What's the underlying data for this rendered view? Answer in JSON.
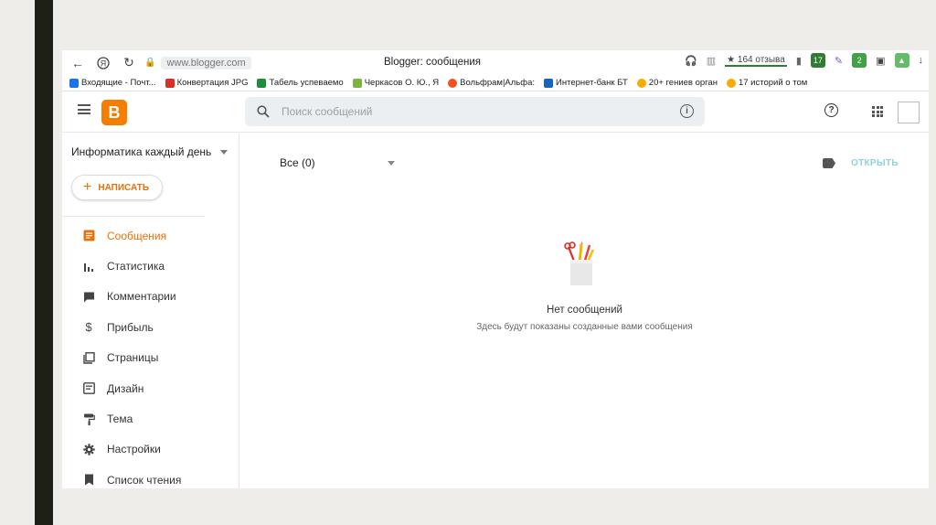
{
  "browser": {
    "url": "www.blogger.com",
    "page_title": "Blogger: сообщения",
    "reviews": "★ 164 отзыва",
    "ext_badge_1": "17",
    "ext_badge_2": "2"
  },
  "bookmarks": [
    {
      "label": "Входящие - Почт...",
      "color": "#1a73e8"
    },
    {
      "label": "Конвертация JPG",
      "color": "#d93025"
    },
    {
      "label": "Табель успеваемо",
      "color": "#1e8e3e"
    },
    {
      "label": "Черкасов О. Ю., Я",
      "color": "#7cb342"
    },
    {
      "label": "Вольфрам|Альфа:",
      "color": "#f4511e"
    },
    {
      "label": "Интернет-банк БТ",
      "color": "#1565c0"
    },
    {
      "label": "20+ гениев орган",
      "color": "#f9ab00"
    },
    {
      "label": "17 историй о том",
      "color": "#f9ab00"
    }
  ],
  "header": {
    "logo_letter": "B",
    "search_placeholder": "Поиск сообщений"
  },
  "sidebar": {
    "blog_name": "Информатика каждый день",
    "new_post": "НАПИСАТЬ",
    "items": [
      {
        "label": "Сообщения",
        "icon": "posts-icon",
        "active": true
      },
      {
        "label": "Статистика",
        "icon": "stats-icon",
        "active": false
      },
      {
        "label": "Комментарии",
        "icon": "comments-icon",
        "active": false
      },
      {
        "label": "Прибыль",
        "icon": "earnings-icon",
        "active": false
      },
      {
        "label": "Страницы",
        "icon": "pages-icon",
        "active": false
      },
      {
        "label": "Дизайн",
        "icon": "layout-icon",
        "active": false
      },
      {
        "label": "Тема",
        "icon": "theme-icon",
        "active": false
      },
      {
        "label": "Настройки",
        "icon": "settings-icon",
        "active": false
      },
      {
        "label": "Список чтения",
        "icon": "reading-list-icon",
        "active": false
      }
    ]
  },
  "main": {
    "filter": "Все (0)",
    "open_button": "ОТКРЫТЬ",
    "empty_title": "Нет сообщений",
    "empty_subtitle": "Здесь будут показаны созданные вами сообщения"
  },
  "colors": {
    "accent": "#e8710a",
    "logo": "#f57d00",
    "open_disabled": "#8fd0dc"
  }
}
